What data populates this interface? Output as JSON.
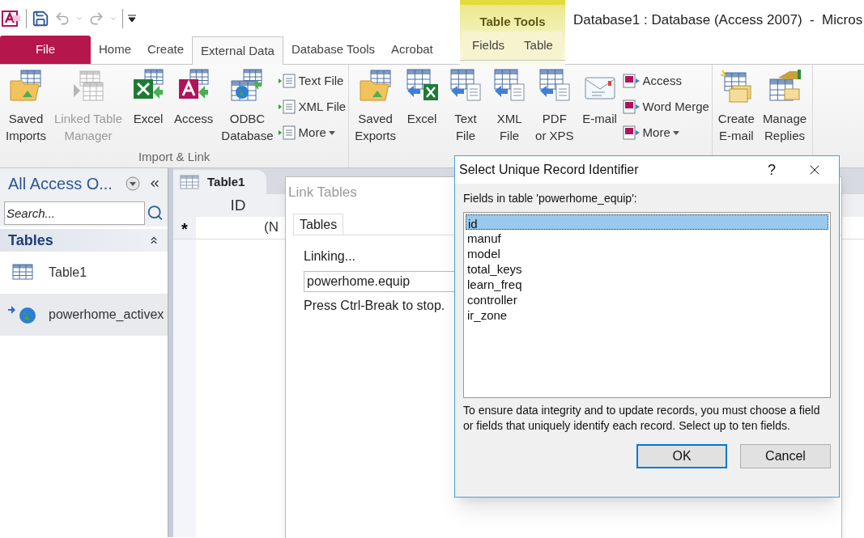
{
  "window_title": "Database1 : Database (Access 2007)  -  Micros",
  "contextual_group": {
    "title": "Table Tools"
  },
  "tabs": [
    {
      "label": "File",
      "selected": false,
      "kind": "file"
    },
    {
      "label": "Home",
      "selected": false,
      "kind": "main"
    },
    {
      "label": "Create",
      "selected": false,
      "kind": "main"
    },
    {
      "label": "External Data",
      "selected": true,
      "kind": "main"
    },
    {
      "label": "Database Tools",
      "selected": false,
      "kind": "main"
    },
    {
      "label": "Acrobat",
      "selected": false,
      "kind": "main"
    },
    {
      "label": "Fields",
      "selected": false,
      "kind": "contextual"
    },
    {
      "label": "Table",
      "selected": false,
      "kind": "contextual"
    }
  ],
  "ribbon_groups": [
    {
      "label": "Import & Link",
      "large_buttons": [
        {
          "lines": [
            "Saved",
            "Imports"
          ],
          "disabled": false
        },
        {
          "lines": [
            "Linked Table",
            "Manager"
          ],
          "disabled": true
        },
        {
          "lines": [
            "Excel"
          ],
          "disabled": false
        },
        {
          "lines": [
            "Access"
          ],
          "disabled": false
        },
        {
          "lines": [
            "ODBC",
            "Database"
          ],
          "disabled": false
        }
      ],
      "small_buttons": [
        {
          "label": "Text File",
          "dropdown": false
        },
        {
          "label": "XML File",
          "dropdown": false
        },
        {
          "label": "More",
          "dropdown": true
        }
      ]
    },
    {
      "large_buttons": [
        {
          "lines": [
            "Saved",
            "Exports"
          ],
          "disabled": false
        },
        {
          "lines": [
            "Excel"
          ],
          "disabled": false
        },
        {
          "lines": [
            "Text",
            "File"
          ],
          "disabled": false
        },
        {
          "lines": [
            "XML",
            "File"
          ],
          "disabled": false
        },
        {
          "lines": [
            "PDF",
            "or XPS"
          ],
          "disabled": false
        },
        {
          "lines": [
            "E-mail"
          ],
          "disabled": false
        }
      ],
      "small_buttons": [
        {
          "label": "Access",
          "dropdown": false
        },
        {
          "label": "Word Merge",
          "dropdown": false
        },
        {
          "label": "More",
          "dropdown": true
        }
      ]
    },
    {
      "large_buttons": [
        {
          "lines": [
            "Create",
            "E-mail"
          ],
          "disabled": false
        },
        {
          "lines": [
            "Manage",
            "Replies"
          ],
          "disabled": false
        }
      ]
    }
  ],
  "nav_pane": {
    "title": "All Access O...",
    "search": {
      "placeholder": "Search..."
    },
    "section": "Tables",
    "items": [
      {
        "label": "Table1",
        "selected": false,
        "kind": "table"
      },
      {
        "label": "powerhome_activex",
        "selected": true,
        "kind": "linked"
      }
    ]
  },
  "document": {
    "tab": "Table1",
    "columns": [
      "ID"
    ],
    "new_row_marker": "*",
    "new_row_cells": [
      "(N"
    ]
  },
  "link_dialog": {
    "title": "Link Tables",
    "tab": "Tables",
    "status": "Linking...",
    "current_table": "powerhome.equip",
    "hint": "Press Ctrl-Break to stop."
  },
  "select_dialog": {
    "title": "Select Unique Record Identifier",
    "help": "?",
    "list_label": "Fields in table 'powerhome_equip':",
    "fields": [
      {
        "label": "id",
        "selected": true
      },
      {
        "label": "manuf",
        "selected": false
      },
      {
        "label": "model",
        "selected": false
      },
      {
        "label": "total_keys",
        "selected": false
      },
      {
        "label": "learn_freq",
        "selected": false
      },
      {
        "label": "controller",
        "selected": false
      },
      {
        "label": "ir_zone",
        "selected": false
      }
    ],
    "note": "To ensure data integrity and to update records, you must choose a field or fields that uniquely identify each record. Select up to ten fields.",
    "buttons": [
      {
        "label": "OK",
        "default": true
      },
      {
        "label": "Cancel",
        "default": false
      }
    ]
  }
}
